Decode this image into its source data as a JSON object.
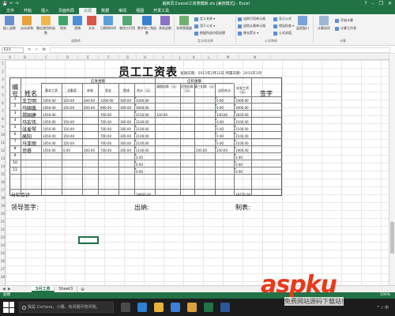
{
  "window": {
    "title": "最新员工excel工资表模板.xls [兼容模式] - Excel",
    "qat": [
      "💾",
      "↶",
      "↷"
    ],
    "controls": [
      "?",
      "–",
      "❐",
      "✕"
    ]
  },
  "tabs": [
    "文件",
    "开始",
    "插入",
    "页面布局",
    "公式",
    "数据",
    "审阅",
    "视图",
    "开发工具"
  ],
  "active_tab": "公式",
  "ribbon": {
    "buttons": [
      {
        "label": "插入函数",
        "color": "#6a8fd0"
      },
      {
        "label": "自动求和",
        "color": "#e8a33c"
      },
      {
        "label": "最近使用的函数",
        "color": "#f0b94a"
      },
      {
        "label": "财务",
        "color": "#3fa56a"
      },
      {
        "label": "逻辑",
        "color": "#4a8fd8"
      },
      {
        "label": "文本",
        "color": "#d8554a"
      },
      {
        "label": "日期和时间",
        "color": "#5aa0d8"
      },
      {
        "label": "查找与引用",
        "color": "#55a874"
      },
      {
        "label": "数学和三角函数",
        "color": "#3a7fcf"
      },
      {
        "label": "其他函数",
        "color": "#8a72c8"
      },
      {
        "label": "名称管理器",
        "color": "#6fb06f"
      }
    ],
    "group_function_library": "函数库",
    "name_small": [
      "定义名称 ▾",
      "用于公式 ▾",
      "根据所选内容创建"
    ],
    "group_defined_names": "定义的名称",
    "audit_small": [
      "追踪引用单元格",
      "追踪从属单元格",
      "移去箭头 ▾",
      "显示公式",
      "错误检查 ▾",
      "公式求值"
    ],
    "group_audit": "公式审核",
    "watch_window": "监视窗口",
    "calc_options": "计算选项",
    "calc_small": [
      "开始计算",
      "计算工作表"
    ],
    "group_calc": "计算"
  },
  "formula_bar": {
    "name_box": "E23",
    "fx": "fx",
    "ctrls": [
      "✕",
      "✓"
    ]
  },
  "columns": [
    "A",
    "B",
    "C",
    "D",
    "E",
    "F",
    "G",
    "H",
    "I",
    "J",
    "K",
    "L",
    "M",
    "N"
  ],
  "rows": [
    "1",
    "2",
    "3",
    "4",
    "5",
    "6",
    "7",
    "8",
    "9",
    "10",
    "11",
    "12",
    "13",
    "14",
    "15",
    "16",
    "17",
    "18",
    "19",
    "20",
    "21",
    "22",
    "23",
    "24",
    "25",
    "26",
    "27",
    "28"
  ],
  "sheet": {
    "title": "员工工资表",
    "subtitle": "发放日期：2015年2月12日  所属日期：2015年1月",
    "hdr_id": "编号",
    "hdr_name": "姓名",
    "hdr_sign": "签字",
    "hdr_payable": "应发金额",
    "hdr_deduct": "应扣金额",
    "hdr_actual": "实发工资（元）",
    "sub_headers": [
      "基本工资",
      "全勤奖",
      "补助",
      "奖金",
      "提成",
      "合计（元）",
      "请假扣款（元）",
      "迟到扣款（元）",
      "满三扣款（元）",
      "应扣合计"
    ],
    "employees": [
      {
        "id": "1",
        "name": "王卫明",
        "vals": [
          "1450.00",
          "150.00",
          "200.00",
          "1200.00",
          "300.00",
          "3300.00",
          "",
          "",
          "",
          "0.00",
          "3300.00"
        ]
      },
      {
        "id": "2",
        "name": "马国鑫",
        "vals": [
          "1450.00",
          "150.00",
          "200.00",
          "900.00",
          "300.00",
          "3000.00",
          "",
          "",
          "",
          "0.00",
          "3000.00"
        ]
      },
      {
        "id": "3",
        "name": "郑国建",
        "vals": [
          "1450.00",
          "",
          "",
          "700.00",
          "",
          "2150.00",
          "330.00",
          "",
          "",
          "330.00",
          "1820.00"
        ]
      },
      {
        "id": "4",
        "name": "马宏伟",
        "vals": [
          "1450.00",
          "150.00",
          "",
          "700.00",
          "300.00",
          "2100.00",
          "",
          "",
          "",
          "0.00",
          "2100.00"
        ]
      },
      {
        "id": "5",
        "name": "张爱琴",
        "vals": [
          "1450.00",
          "150.00",
          "",
          "700.00",
          "300.00",
          "2100.00",
          "",
          "",
          "",
          "0.00",
          "2100.00"
        ]
      },
      {
        "id": "6",
        "name": "高阳",
        "vals": [
          "1450.00",
          "150.00",
          "",
          "700.00",
          "300.00",
          "2100.00",
          "",
          "",
          "",
          "0.00",
          "2100.00"
        ]
      },
      {
        "id": "7",
        "name": "马亚丽",
        "vals": [
          "1450.00",
          "150.00",
          "",
          "700.00",
          "300.00",
          "2100.00",
          "",
          "",
          "",
          "0.00",
          "2100.00"
        ]
      },
      {
        "id": "8",
        "name": "司睿",
        "vals": [
          "1450.00",
          "0.00",
          "100.00",
          "700.00",
          "300.00",
          "2100.00",
          "",
          "",
          "200.00",
          "200.00",
          "1900.00"
        ]
      },
      {
        "id": "9",
        "name": "",
        "vals": [
          "",
          "",
          "",
          "",
          "",
          "0.00",
          "",
          "",
          "",
          "",
          "0.00"
        ]
      },
      {
        "id": "10",
        "name": "",
        "vals": [
          "",
          "",
          "",
          "",
          "",
          "0.00",
          "",
          "",
          "",
          "",
          "0.00"
        ]
      },
      {
        "id": "11",
        "name": "",
        "vals": [
          "",
          "",
          "",
          "",
          "",
          "0.00",
          "",
          "",
          "",
          "",
          "0.00"
        ]
      }
    ],
    "total_label": "分栏合计",
    "total_sum": "18950.00",
    "total_actual": "18770.00",
    "footer_leader": "领导签字:",
    "footer_cashier": "出纳:",
    "footer_maker": "制表:"
  },
  "sheet_tabs": [
    "5月工资",
    "Sheet3"
  ],
  "active_sheet": "5月工资",
  "status": {
    "ready": "就绪",
    "zoom": "100%"
  },
  "taskbar": {
    "search_placeholder": "我是 Cortana，小娜。有问题尽管问我。",
    "icons": [
      {
        "name": "task-view-icon",
        "color": "#4a4a4a"
      },
      {
        "name": "edge-icon",
        "color": "#2d7fd3"
      },
      {
        "name": "explorer-icon",
        "color": "#e8b23c"
      },
      {
        "name": "store-icon",
        "color": "#3a7fd8"
      },
      {
        "name": "chrome-icon",
        "color": "#d8a13a"
      },
      {
        "name": "excel-icon",
        "color": "#217346"
      },
      {
        "name": "word-icon",
        "color": "#2b579a"
      }
    ],
    "tray": "^ ♪ 中"
  },
  "watermark": {
    "main": "aspku",
    "sub": "免费网站源码下载站!"
  }
}
